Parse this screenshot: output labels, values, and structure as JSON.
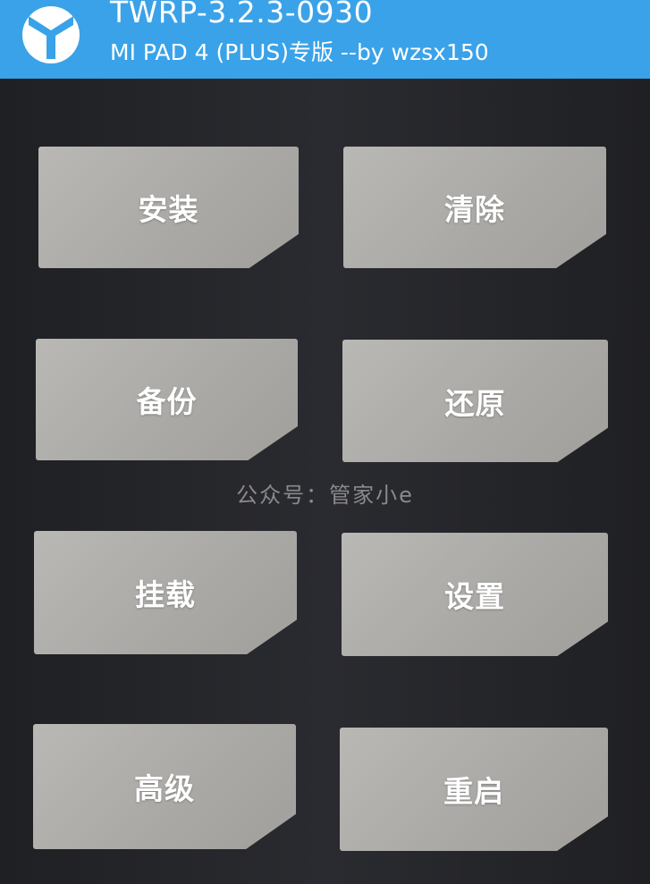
{
  "header": {
    "title": "TWRP-3.2.3-0930",
    "subtitle": "MI PAD 4 (PLUS)专版  --by wzsx150",
    "accent_color": "#3aa2e8",
    "logo_icon": "twrp-logo-icon"
  },
  "menu": {
    "install": "安装",
    "wipe": "清除",
    "backup": "备份",
    "restore": "还原",
    "mount": "挂载",
    "settings": "设置",
    "advanced": "高级",
    "reboot": "重启"
  },
  "watermark": "公众号：管家小e"
}
